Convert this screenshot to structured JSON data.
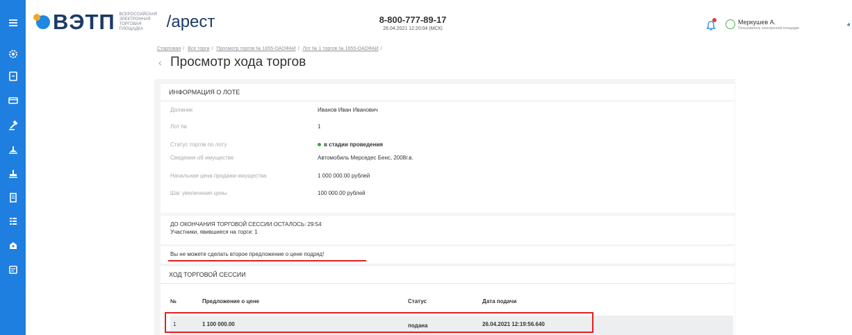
{
  "sidebar": {
    "items": [
      {
        "icon": "menu-icon"
      },
      {
        "icon": "settings-icon"
      },
      {
        "icon": "document-icon"
      },
      {
        "icon": "card-icon"
      },
      {
        "icon": "gavel-icon"
      },
      {
        "icon": "scale-icon"
      },
      {
        "icon": "hammer-icon"
      },
      {
        "icon": "receipt-icon"
      },
      {
        "icon": "list-icon"
      },
      {
        "icon": "bag-icon"
      },
      {
        "icon": "calendar-icon"
      }
    ],
    "color": "#1e7fe0"
  },
  "header": {
    "logo": "ВЭТП",
    "logo_sub": "ВСЕРОССИЙСКАЯ ЭЛЕКТРОННАЯ ТОРГОВАЯ ПЛОЩАДКА",
    "section": "/арест",
    "phone": "8-800-777-89-17",
    "datetime": "26.04.2021 12:20:04 (МСК)",
    "user_name": "Меркушев А.",
    "user_role": "Пользователь электронной площадки"
  },
  "breadcrumb": [
    "Стартовая",
    "Все торги",
    "Просмотр торгов № 1655-ОАОФАИ",
    "Лот № 1 торгов № 1655-ОАОФАИ"
  ],
  "page_title": "Просмотр хода торгов",
  "lot_info": {
    "header": "ИНФОРМАЦИЯ О ЛОТЕ",
    "rows": [
      {
        "label": "Должник",
        "value": "Иванов Иван Иванович"
      },
      {
        "label": "Лот №",
        "value": "1"
      },
      {
        "label": "Статус торгов по лоту",
        "value": "в стадии проведения"
      },
      {
        "label": "Сведения об имуществе",
        "value": "Автомобиль Мерседес Бенс, 2008г.в."
      },
      {
        "label": "Начальная цена продажи имущества",
        "value": "1 000 000.00 рублей"
      },
      {
        "label": "Шаг увеличения цены",
        "value": "100 000.00 рублей"
      }
    ]
  },
  "session": {
    "timer": "ДО ОКОНЧАНИЯ ТОРГОВОЙ СЕССИИ ОСТАЛОСЬ: 29:54",
    "participants": "Участники, явившиеся на торги: 1"
  },
  "warning": "Вы не можете сделать второе предложение о цене подряд!",
  "progress": {
    "header": "ХОД ТОРГОВОЙ СЕССИИ",
    "columns": [
      "№",
      "Предложение о цене",
      "Статус",
      "Дата подачи"
    ],
    "rows": [
      {
        "num": "1",
        "price": "1 100 000.00",
        "status": "подана",
        "date": "26.04.2021 12:19:56.640"
      }
    ]
  }
}
